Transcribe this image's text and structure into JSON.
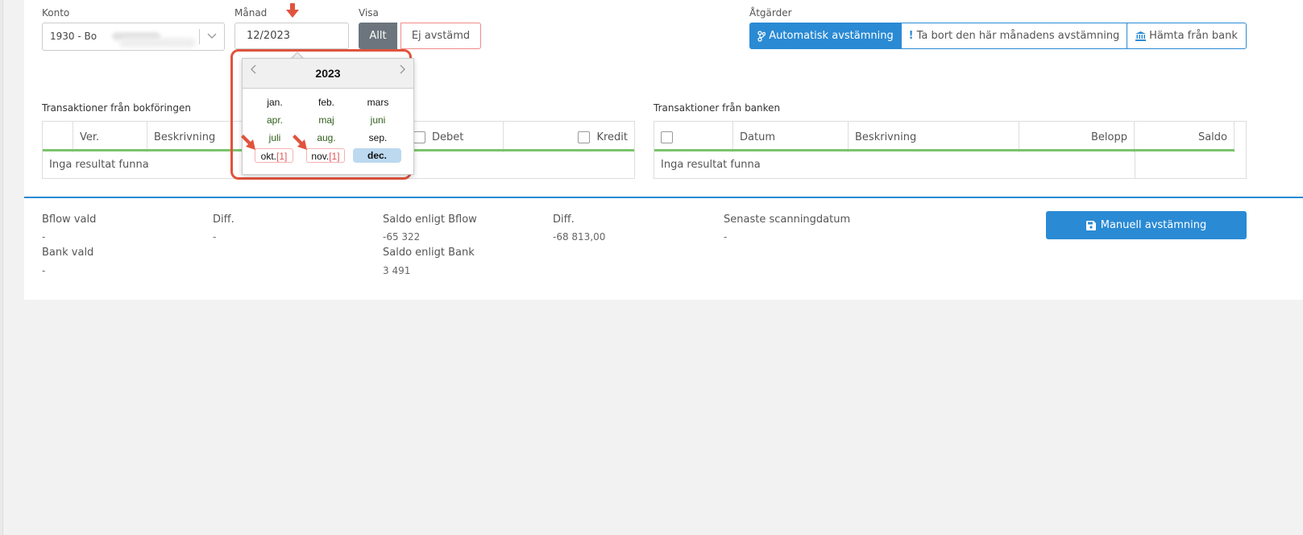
{
  "filters": {
    "account_label": "Konto",
    "account_value": "1930 - Bo",
    "month_label": "Månad",
    "month_value": "12/2023",
    "show_label": "Visa",
    "show_all": "Allt",
    "show_unreconciled": "Ej avstämd"
  },
  "actions": {
    "label": "Åtgärder",
    "auto_reconcile": "Automatisk avstämning",
    "remove_month": "Ta bort den här månadens avstämning",
    "fetch_bank": "Hämta från bank"
  },
  "datepicker": {
    "year": "2023",
    "months": [
      {
        "label": "jan.",
        "badge": ""
      },
      {
        "label": "feb.",
        "badge": ""
      },
      {
        "label": "mars",
        "badge": ""
      },
      {
        "label": "apr.",
        "badge": ""
      },
      {
        "label": "maj",
        "badge": ""
      },
      {
        "label": "juni",
        "badge": ""
      },
      {
        "label": "juli",
        "badge": ""
      },
      {
        "label": "aug.",
        "badge": ""
      },
      {
        "label": "sep.",
        "badge": ""
      },
      {
        "label": "okt.",
        "badge": "[1]"
      },
      {
        "label": "nov.",
        "badge": "[1]"
      },
      {
        "label": "dec.",
        "badge": ""
      }
    ],
    "selected": "dec."
  },
  "books_table": {
    "title": "Transaktioner från bokföringen",
    "columns": [
      "Ver.",
      "Beskrivning",
      "Debet",
      "Kredit"
    ],
    "empty": "Inga resultat funna"
  },
  "bank_table": {
    "title": "Transaktioner från banken",
    "columns": [
      "Datum",
      "Beskrivning",
      "Belopp",
      "Saldo"
    ],
    "empty": "Inga resultat funna"
  },
  "summary": {
    "bflow_selected_label": "Bflow vald",
    "bflow_selected_value": "-",
    "diff1_label": "Diff.",
    "diff1_value": "-",
    "balance_bflow_label": "Saldo enligt Bflow",
    "balance_bflow_value": "-65 322",
    "diff2_label": "Diff.",
    "diff2_value": "-68 813,00",
    "last_scan_label": "Senaste scanningdatum",
    "last_scan_value": "-",
    "bank_selected_label": "Bank vald",
    "bank_selected_value": "-",
    "balance_bank_label": "Saldo enligt Bank",
    "balance_bank_value": "3 491",
    "manual_button": "Manuell avstämning"
  },
  "colors": {
    "primary": "#2a8ad4",
    "grey_button": "#6c757d",
    "annotation_red": "#e0533d",
    "table_underline": "#7bc46b"
  }
}
